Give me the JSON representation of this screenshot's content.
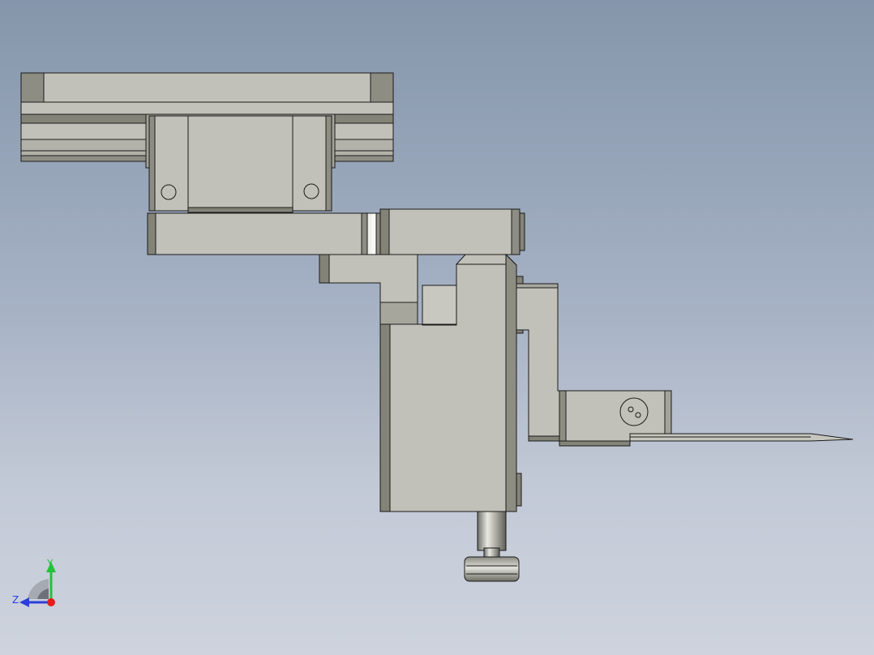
{
  "viewport": {
    "background_top": "#8596ab",
    "background_bottom": "#ced3dd"
  },
  "model": {
    "face_color": "#c1c1b9",
    "shadow_color": "#838378",
    "edge_color": "#1a1a1a"
  },
  "triad": {
    "y_label": "Y",
    "z_label": "Z",
    "y_color": "#22c23a",
    "z_color": "#2b3fd8",
    "x_color": "#e51c1c"
  }
}
